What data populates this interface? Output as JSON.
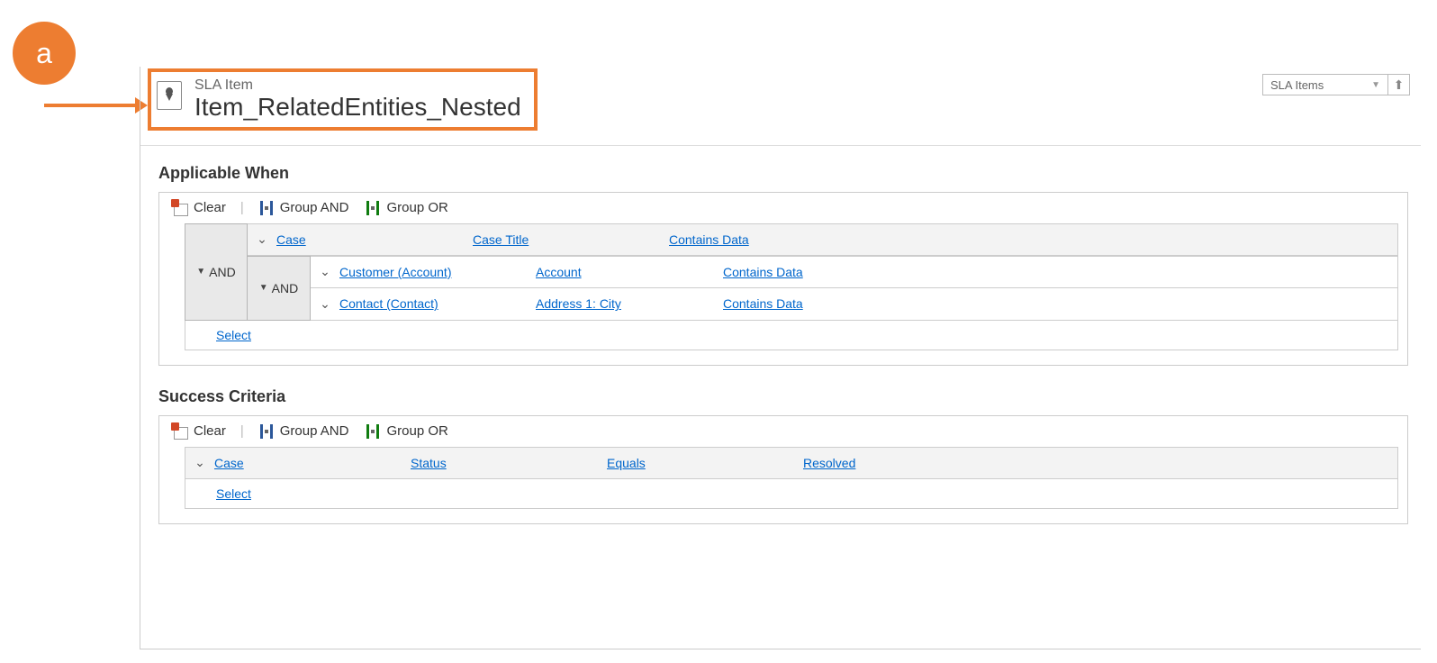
{
  "callout": {
    "letter": "a"
  },
  "header": {
    "entity_label": "SLA Item",
    "title": "Item_RelatedEntities_Nested",
    "lookup_text": "SLA Items"
  },
  "toolbar": {
    "clear": "Clear",
    "group_and": "Group AND",
    "group_or": "Group OR"
  },
  "logic": {
    "and": "AND"
  },
  "sections": {
    "applicable": {
      "title": "Applicable When",
      "row1": {
        "entity": "Case",
        "field": "Case Title",
        "op": "Contains Data"
      },
      "nested": {
        "rowA": {
          "entity": "Customer (Account)",
          "field": "Account",
          "op": "Contains Data"
        },
        "rowB": {
          "entity": "Contact (Contact)",
          "field": "Address 1: City",
          "op": "Contains Data"
        }
      },
      "select": "Select"
    },
    "success": {
      "title": "Success Criteria",
      "row1": {
        "entity": "Case",
        "field": "Status",
        "op": "Equals",
        "value": "Resolved"
      },
      "select": "Select"
    }
  }
}
